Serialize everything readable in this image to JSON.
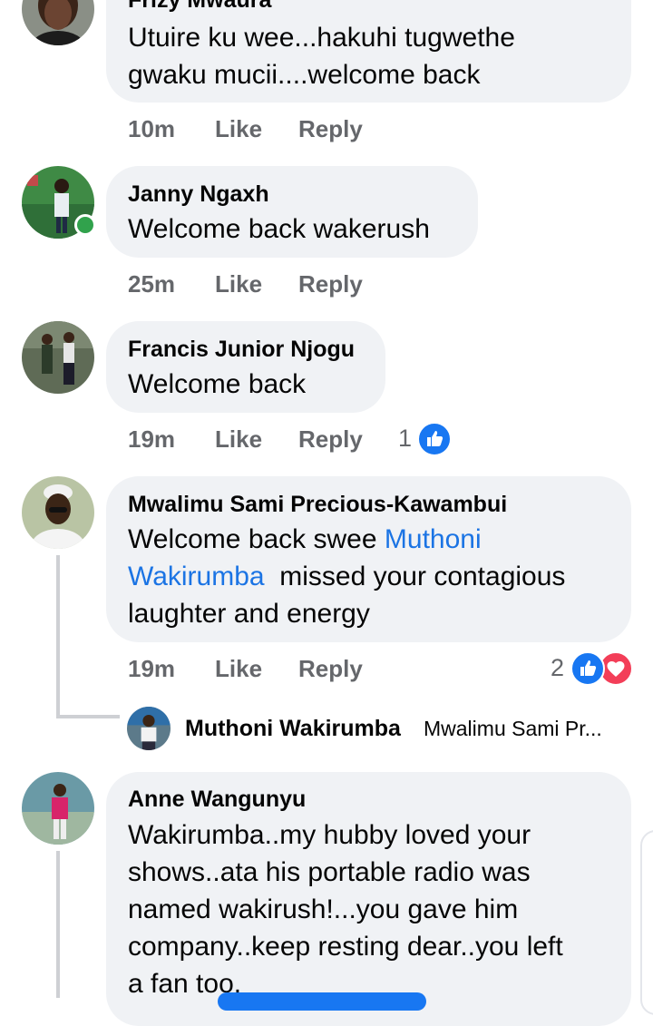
{
  "comments": [
    {
      "author": "Frizy Mwaura",
      "lines": [
        "Utuire ku wee...hakuhi tugwethe",
        "gwaku mucii....welcome back"
      ],
      "time": "10m",
      "like": "Like",
      "reply": "Reply"
    },
    {
      "author": "Janny Ngaxh",
      "lines": [
        "Welcome back wakerush"
      ],
      "time": "25m",
      "like": "Like",
      "reply": "Reply"
    },
    {
      "author": "Francis Junior Njogu",
      "lines": [
        "Welcome back"
      ],
      "time": "19m",
      "like": "Like",
      "reply": "Reply",
      "reaction_count": "1"
    },
    {
      "author": "Mwalimu Sami Precious-Kawambui",
      "line1_text": "Welcome back swee ",
      "line1_mention": "Muthoni",
      "line2_mention": "Wakirumba",
      "line2_text": "  missed your contagious",
      "line3_text": "laughter and energy",
      "time": "19m",
      "like": "Like",
      "reply": "Reply",
      "reaction_count": "2",
      "reply_preview": {
        "author": "Muthoni Wakirumba",
        "snippet": "Mwalimu Sami Pr..."
      }
    },
    {
      "author": "Anne Wangunyu",
      "lines": [
        "Wakirumba..my hubby loved your",
        "shows..ata his portable radio was",
        "named wakirush!...you gave him",
        "company..keep resting dear..you left",
        "a fan too."
      ]
    }
  ],
  "colors": {
    "bubble": "#f0f2f5",
    "meta": "#65676b",
    "mention": "#1b74e4",
    "like_blue": "#1877f2",
    "love_red": "#f33e58",
    "online_green": "#31a24c"
  }
}
